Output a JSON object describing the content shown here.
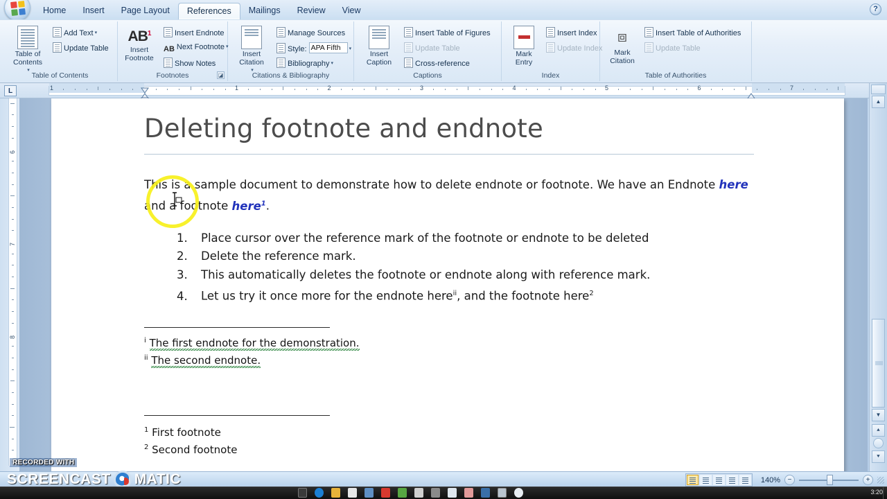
{
  "app": {
    "office_button": "office-orb",
    "help_button": "?"
  },
  "ribbon": {
    "tabs": [
      {
        "label": "Home",
        "active": false
      },
      {
        "label": "Insert",
        "active": false
      },
      {
        "label": "Page Layout",
        "active": false
      },
      {
        "label": "References",
        "active": true
      },
      {
        "label": "Mailings",
        "active": false
      },
      {
        "label": "Review",
        "active": false
      },
      {
        "label": "View",
        "active": false
      }
    ],
    "groups": [
      {
        "name": "Table of Contents",
        "label": "Table of Contents",
        "big_button": "Table of\nContents",
        "big_button_line1": "Table of",
        "big_button_line2": "Contents",
        "items": [
          {
            "label": "Add Text",
            "dropdown": true,
            "disabled": false
          },
          {
            "label": "Update Table",
            "dropdown": false,
            "disabled": false
          }
        ]
      },
      {
        "name": "Footnotes",
        "label": "Footnotes",
        "big_button_line1": "Insert",
        "big_button_line2": "Footnote",
        "big_icon": "AB1",
        "items": [
          {
            "label": "Insert Endnote",
            "dropdown": false,
            "disabled": false
          },
          {
            "label": "Next Footnote",
            "dropdown": true,
            "disabled": false
          },
          {
            "label": "Show Notes",
            "dropdown": false,
            "disabled": false
          }
        ],
        "has_dialog_launcher": true
      },
      {
        "name": "Citations & Bibliography",
        "label": "Citations & Bibliography",
        "big_button_line1": "Insert",
        "big_button_line2": "Citation",
        "big_dropdown": true,
        "items": [
          {
            "label": "Manage Sources",
            "dropdown": false,
            "disabled": false
          },
          {
            "label": "Style:",
            "dropdown": false,
            "disabled": false
          },
          {
            "label": "Bibliography",
            "dropdown": true,
            "disabled": false
          }
        ],
        "style_value": "APA Fifth"
      },
      {
        "name": "Captions",
        "label": "Captions",
        "big_button_line1": "Insert",
        "big_button_line2": "Caption",
        "items": [
          {
            "label": "Insert Table of Figures",
            "dropdown": false,
            "disabled": false
          },
          {
            "label": "Update Table",
            "dropdown": false,
            "disabled": true
          },
          {
            "label": "Cross-reference",
            "dropdown": false,
            "disabled": false
          }
        ]
      },
      {
        "name": "Index",
        "label": "Index",
        "big_button_line1": "Mark",
        "big_button_line2": "Entry",
        "items": [
          {
            "label": "Insert Index",
            "dropdown": false,
            "disabled": false
          },
          {
            "label": "Update Index",
            "dropdown": false,
            "disabled": true
          }
        ]
      },
      {
        "name": "Table of Authorities",
        "label": "Table of Authorities",
        "big_button_line1": "Mark",
        "big_button_line2": "Citation",
        "items": [
          {
            "label": "Insert Table of Authorities",
            "dropdown": false,
            "disabled": false
          },
          {
            "label": "Update Table",
            "dropdown": false,
            "disabled": true
          }
        ]
      }
    ]
  },
  "ruler": {
    "corner_label": "L",
    "horizontal_numbers": [
      "1",
      "1",
      "2",
      "1",
      "3",
      "4",
      "5",
      "1",
      "6",
      "7"
    ],
    "vertical_numbers": [
      "6",
      "7",
      "8"
    ]
  },
  "document": {
    "title": "Deleting footnote and endnote",
    "paragraph": {
      "part1": "This is a sample document to demonstrate how to delete endnote or footnote. We have an Endnote ",
      "link1": "here",
      "part2": " and a footnote ",
      "link2": "here",
      "link2_sup": "1",
      "part3": "."
    },
    "steps": [
      "Place cursor over the reference mark of the footnote or endnote to be deleted",
      "Delete the reference mark.",
      "This automatically deletes the footnote or endnote along with reference mark.",
      "Let us try it once more for the endnote here"
    ],
    "step4": {
      "prefix": "Let us try it once more for the endnote here",
      "mark1": "ii",
      "middle": ", and the footnote here",
      "mark2": "2"
    },
    "endnotes": [
      {
        "mark": "i",
        "text": "The first endnote for the demonstration."
      },
      {
        "mark": "ii",
        "text": "The second endnote."
      }
    ],
    "footnotes": [
      {
        "mark": "1",
        "text": "First footnote"
      },
      {
        "mark": "2",
        "text": "Second footnote"
      }
    ]
  },
  "status_bar": {
    "zoom_level": "140%",
    "zoom_out": "−",
    "zoom_in": "+",
    "view_buttons": [
      "print-layout",
      "full-screen-reading",
      "web-layout",
      "outline",
      "draft"
    ]
  },
  "watermark": {
    "line1": "RECORDED WITH",
    "line2_left": "SCREENCAST",
    "line2_right": "MATIC"
  },
  "taskbar": {
    "clock": "3:20"
  },
  "colors": {
    "accent": "#2233bb",
    "title_text": "#4c4c4c",
    "highlight_ring": "#f7f01a",
    "grammar_squiggle": "#1a7a2e",
    "ribbon_bg": "#dae8f6"
  }
}
